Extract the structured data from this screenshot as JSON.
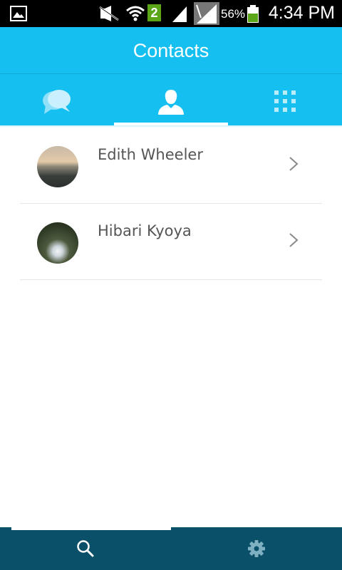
{
  "status_bar": {
    "battery_percent": "56%",
    "time": "4:34 PM",
    "badge": "2",
    "icons": [
      "gallery-icon",
      "mute-icon",
      "wifi-icon",
      "signal-icon",
      "signal-icon-2",
      "battery-icon"
    ]
  },
  "app_bar": {
    "title": "Contacts"
  },
  "tabs": [
    {
      "icon": "chat-bubbles-icon",
      "selected": false
    },
    {
      "icon": "person-icon",
      "selected": true
    },
    {
      "icon": "grid-icon",
      "selected": false
    }
  ],
  "contacts": [
    {
      "name": "Edith Wheeler",
      "avatar": "photo"
    },
    {
      "name": "Hibari Kyoya",
      "avatar": "photo"
    }
  ],
  "bottom_nav": [
    {
      "icon": "search-icon",
      "selected": true
    },
    {
      "icon": "gear-icon",
      "selected": false
    }
  ],
  "colors": {
    "accent": "#15c0f1",
    "bottom_bar": "#0a5068",
    "status_bar": "#000000"
  }
}
